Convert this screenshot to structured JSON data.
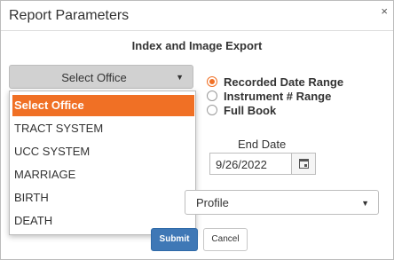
{
  "dialog": {
    "title": "Report Parameters",
    "close_icon": "×",
    "subtitle": "Index and Image Export"
  },
  "office_select": {
    "value": "Select Office",
    "caret": "▼"
  },
  "office_options": [
    "Select Office",
    "TRACT SYSTEM",
    "UCC SYSTEM",
    "MARRIAGE",
    "BIRTH",
    "DEATH"
  ],
  "range_options": [
    {
      "label": "Recorded Date Range",
      "checked": true
    },
    {
      "label": "Instrument # Range",
      "checked": false
    },
    {
      "label": "Full Book",
      "checked": false
    }
  ],
  "end_date": {
    "label": "End Date",
    "value": "9/26/2022"
  },
  "profile_select": {
    "value": "Profile",
    "caret": "▼"
  },
  "buttons": {
    "submit": "Submit",
    "cancel": "Cancel"
  },
  "colors": {
    "accent": "#f07025",
    "primary": "#3f78b6"
  }
}
